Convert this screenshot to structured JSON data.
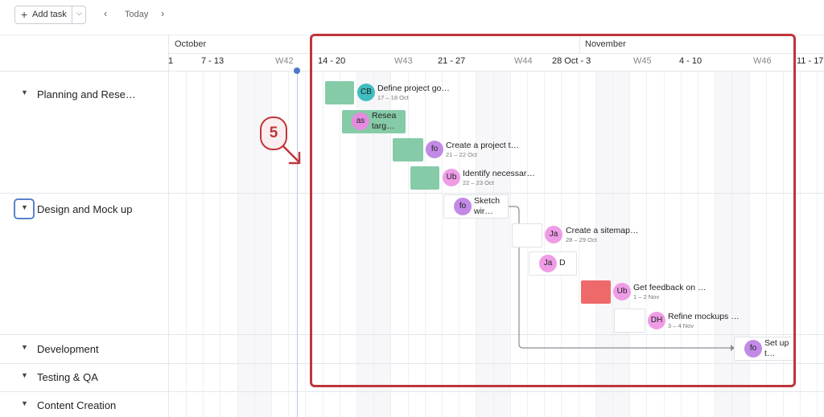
{
  "toolbar": {
    "add_task_label": "Add task",
    "today_label": "Today"
  },
  "timeline": {
    "months": [
      "October",
      "November"
    ],
    "weeks": [
      {
        "range": "1",
        "code": ""
      },
      {
        "range": "7 - 13",
        "code": "W42"
      },
      {
        "range": "14 - 20",
        "code": "W43"
      },
      {
        "range": "21 - 27",
        "code": "W44"
      },
      {
        "range": "28 Oct - 3",
        "code": "W45"
      },
      {
        "range": "4 - 10",
        "code": "W46"
      },
      {
        "range": "11 - 17",
        "code": ""
      }
    ]
  },
  "groups": [
    {
      "label": "Planning and Rese…"
    },
    {
      "label": "Design and Mock up"
    },
    {
      "label": "Development"
    },
    {
      "label": "Testing & QA"
    },
    {
      "label": "Content Creation"
    }
  ],
  "tasks": [
    {
      "avatar": "CB",
      "avatar_color": "#3fbdc0",
      "name": "Define project go…",
      "dates": "17 – 18 Oct",
      "style": "green"
    },
    {
      "avatar": "as",
      "avatar_color": "#e58be0",
      "name": "Resea targ…",
      "dates": "",
      "style": "green"
    },
    {
      "avatar": "fo",
      "avatar_color": "#c28ae6",
      "name": "Create a project t…",
      "dates": "21 – 22 Oct",
      "style": "green"
    },
    {
      "avatar": "Ub",
      "avatar_color": "#ef9ce6",
      "name": "Identify necessar…",
      "dates": "22 – 23 Oct",
      "style": "green"
    },
    {
      "avatar": "fo",
      "avatar_color": "#c28ae6",
      "name": "Sketch wir…",
      "dates": "",
      "style": "empty"
    },
    {
      "avatar": "Ja",
      "avatar_color": "#ef9ce6",
      "name": "Create a sitemap…",
      "dates": "28 – 29 Oct",
      "style": "empty"
    },
    {
      "avatar": "Ja",
      "avatar_color": "#ef9ce6",
      "name": "D",
      "dates": "",
      "style": "empty"
    },
    {
      "avatar": "Ub",
      "avatar_color": "#ef9ce6",
      "name": "Get feedback on …",
      "dates": "1 – 2 Nov",
      "style": "red"
    },
    {
      "avatar": "DH",
      "avatar_color": "#ef9ce6",
      "name": "Refine mockups …",
      "dates": "3 – 4 Nov",
      "style": "empty"
    },
    {
      "avatar": "fo",
      "avatar_color": "#c28ae6",
      "name": "Set up t…",
      "dates": "",
      "style": "empty"
    }
  ],
  "annotation": {
    "step": "5"
  },
  "colors": {
    "accent": "#5a82c9",
    "highlight": "#c0353b",
    "today_marker": "#4a78c8"
  }
}
